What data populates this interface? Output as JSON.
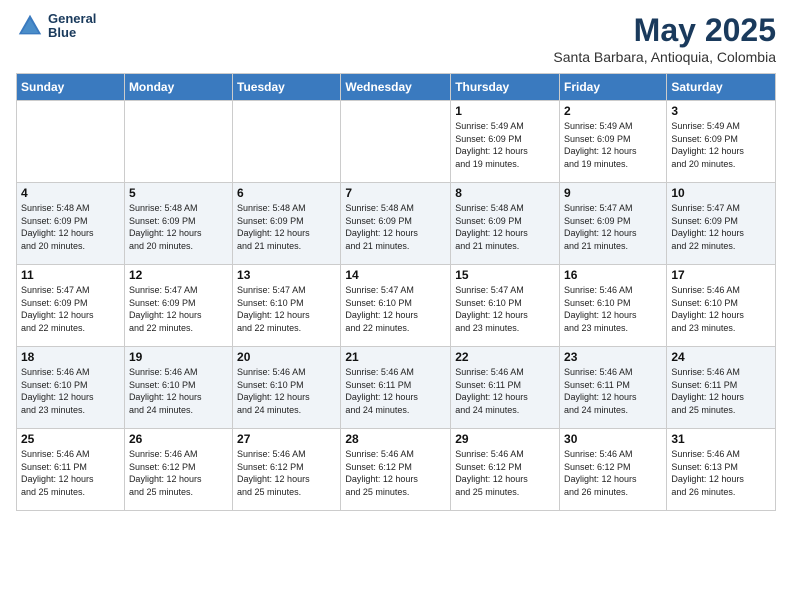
{
  "header": {
    "logo_line1": "General",
    "logo_line2": "Blue",
    "month_title": "May 2025",
    "subtitle": "Santa Barbara, Antioquia, Colombia"
  },
  "days_of_week": [
    "Sunday",
    "Monday",
    "Tuesday",
    "Wednesday",
    "Thursday",
    "Friday",
    "Saturday"
  ],
  "weeks": [
    [
      {
        "day": "",
        "info": ""
      },
      {
        "day": "",
        "info": ""
      },
      {
        "day": "",
        "info": ""
      },
      {
        "day": "",
        "info": ""
      },
      {
        "day": "1",
        "info": "Sunrise: 5:49 AM\nSunset: 6:09 PM\nDaylight: 12 hours\nand 19 minutes."
      },
      {
        "day": "2",
        "info": "Sunrise: 5:49 AM\nSunset: 6:09 PM\nDaylight: 12 hours\nand 19 minutes."
      },
      {
        "day": "3",
        "info": "Sunrise: 5:49 AM\nSunset: 6:09 PM\nDaylight: 12 hours\nand 20 minutes."
      }
    ],
    [
      {
        "day": "4",
        "info": "Sunrise: 5:48 AM\nSunset: 6:09 PM\nDaylight: 12 hours\nand 20 minutes."
      },
      {
        "day": "5",
        "info": "Sunrise: 5:48 AM\nSunset: 6:09 PM\nDaylight: 12 hours\nand 20 minutes."
      },
      {
        "day": "6",
        "info": "Sunrise: 5:48 AM\nSunset: 6:09 PM\nDaylight: 12 hours\nand 21 minutes."
      },
      {
        "day": "7",
        "info": "Sunrise: 5:48 AM\nSunset: 6:09 PM\nDaylight: 12 hours\nand 21 minutes."
      },
      {
        "day": "8",
        "info": "Sunrise: 5:48 AM\nSunset: 6:09 PM\nDaylight: 12 hours\nand 21 minutes."
      },
      {
        "day": "9",
        "info": "Sunrise: 5:47 AM\nSunset: 6:09 PM\nDaylight: 12 hours\nand 21 minutes."
      },
      {
        "day": "10",
        "info": "Sunrise: 5:47 AM\nSunset: 6:09 PM\nDaylight: 12 hours\nand 22 minutes."
      }
    ],
    [
      {
        "day": "11",
        "info": "Sunrise: 5:47 AM\nSunset: 6:09 PM\nDaylight: 12 hours\nand 22 minutes."
      },
      {
        "day": "12",
        "info": "Sunrise: 5:47 AM\nSunset: 6:09 PM\nDaylight: 12 hours\nand 22 minutes."
      },
      {
        "day": "13",
        "info": "Sunrise: 5:47 AM\nSunset: 6:10 PM\nDaylight: 12 hours\nand 22 minutes."
      },
      {
        "day": "14",
        "info": "Sunrise: 5:47 AM\nSunset: 6:10 PM\nDaylight: 12 hours\nand 22 minutes."
      },
      {
        "day": "15",
        "info": "Sunrise: 5:47 AM\nSunset: 6:10 PM\nDaylight: 12 hours\nand 23 minutes."
      },
      {
        "day": "16",
        "info": "Sunrise: 5:46 AM\nSunset: 6:10 PM\nDaylight: 12 hours\nand 23 minutes."
      },
      {
        "day": "17",
        "info": "Sunrise: 5:46 AM\nSunset: 6:10 PM\nDaylight: 12 hours\nand 23 minutes."
      }
    ],
    [
      {
        "day": "18",
        "info": "Sunrise: 5:46 AM\nSunset: 6:10 PM\nDaylight: 12 hours\nand 23 minutes."
      },
      {
        "day": "19",
        "info": "Sunrise: 5:46 AM\nSunset: 6:10 PM\nDaylight: 12 hours\nand 24 minutes."
      },
      {
        "day": "20",
        "info": "Sunrise: 5:46 AM\nSunset: 6:10 PM\nDaylight: 12 hours\nand 24 minutes."
      },
      {
        "day": "21",
        "info": "Sunrise: 5:46 AM\nSunset: 6:11 PM\nDaylight: 12 hours\nand 24 minutes."
      },
      {
        "day": "22",
        "info": "Sunrise: 5:46 AM\nSunset: 6:11 PM\nDaylight: 12 hours\nand 24 minutes."
      },
      {
        "day": "23",
        "info": "Sunrise: 5:46 AM\nSunset: 6:11 PM\nDaylight: 12 hours\nand 24 minutes."
      },
      {
        "day": "24",
        "info": "Sunrise: 5:46 AM\nSunset: 6:11 PM\nDaylight: 12 hours\nand 25 minutes."
      }
    ],
    [
      {
        "day": "25",
        "info": "Sunrise: 5:46 AM\nSunset: 6:11 PM\nDaylight: 12 hours\nand 25 minutes."
      },
      {
        "day": "26",
        "info": "Sunrise: 5:46 AM\nSunset: 6:12 PM\nDaylight: 12 hours\nand 25 minutes."
      },
      {
        "day": "27",
        "info": "Sunrise: 5:46 AM\nSunset: 6:12 PM\nDaylight: 12 hours\nand 25 minutes."
      },
      {
        "day": "28",
        "info": "Sunrise: 5:46 AM\nSunset: 6:12 PM\nDaylight: 12 hours\nand 25 minutes."
      },
      {
        "day": "29",
        "info": "Sunrise: 5:46 AM\nSunset: 6:12 PM\nDaylight: 12 hours\nand 25 minutes."
      },
      {
        "day": "30",
        "info": "Sunrise: 5:46 AM\nSunset: 6:12 PM\nDaylight: 12 hours\nand 26 minutes."
      },
      {
        "day": "31",
        "info": "Sunrise: 5:46 AM\nSunset: 6:13 PM\nDaylight: 12 hours\nand 26 minutes."
      }
    ]
  ]
}
